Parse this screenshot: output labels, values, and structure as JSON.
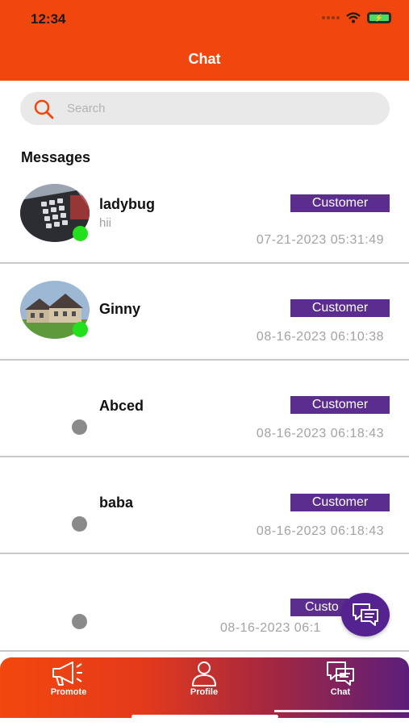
{
  "status_bar": {
    "time": "12:34",
    "battery_glyph": "⚡"
  },
  "header": {
    "title": "Chat"
  },
  "search": {
    "placeholder": "Search"
  },
  "section_title": "Messages",
  "conversations": [
    {
      "name": "ladybug",
      "preview": "hii",
      "badge": "Customer",
      "timestamp": "07-21-2023 05:31:49",
      "online": true
    },
    {
      "name": "Ginny",
      "preview": "",
      "badge": "Customer",
      "timestamp": "08-16-2023 06:10:38",
      "online": true
    },
    {
      "name": "Abced",
      "preview": "",
      "badge": "Customer",
      "timestamp": "08-16-2023 06:18:43",
      "online": false
    },
    {
      "name": "baba",
      "preview": "",
      "badge": "Customer",
      "timestamp": "08-16-2023 06:18:43",
      "online": false
    },
    {
      "name": "",
      "preview": "",
      "badge": "Custo",
      "timestamp": "08-16-2023 06:1",
      "online": false
    }
  ],
  "tabs": [
    {
      "label": "Promote",
      "icon": "megaphone-icon"
    },
    {
      "label": "Profile",
      "icon": "user-icon"
    },
    {
      "label": "Chat",
      "icon": "chat-icon",
      "active": true
    }
  ],
  "colors": {
    "brand_orange": "#f2460f",
    "badge_purple": "#5b2d8e",
    "online_green": "#22e01b",
    "offline_gray": "#8a8a8a"
  }
}
